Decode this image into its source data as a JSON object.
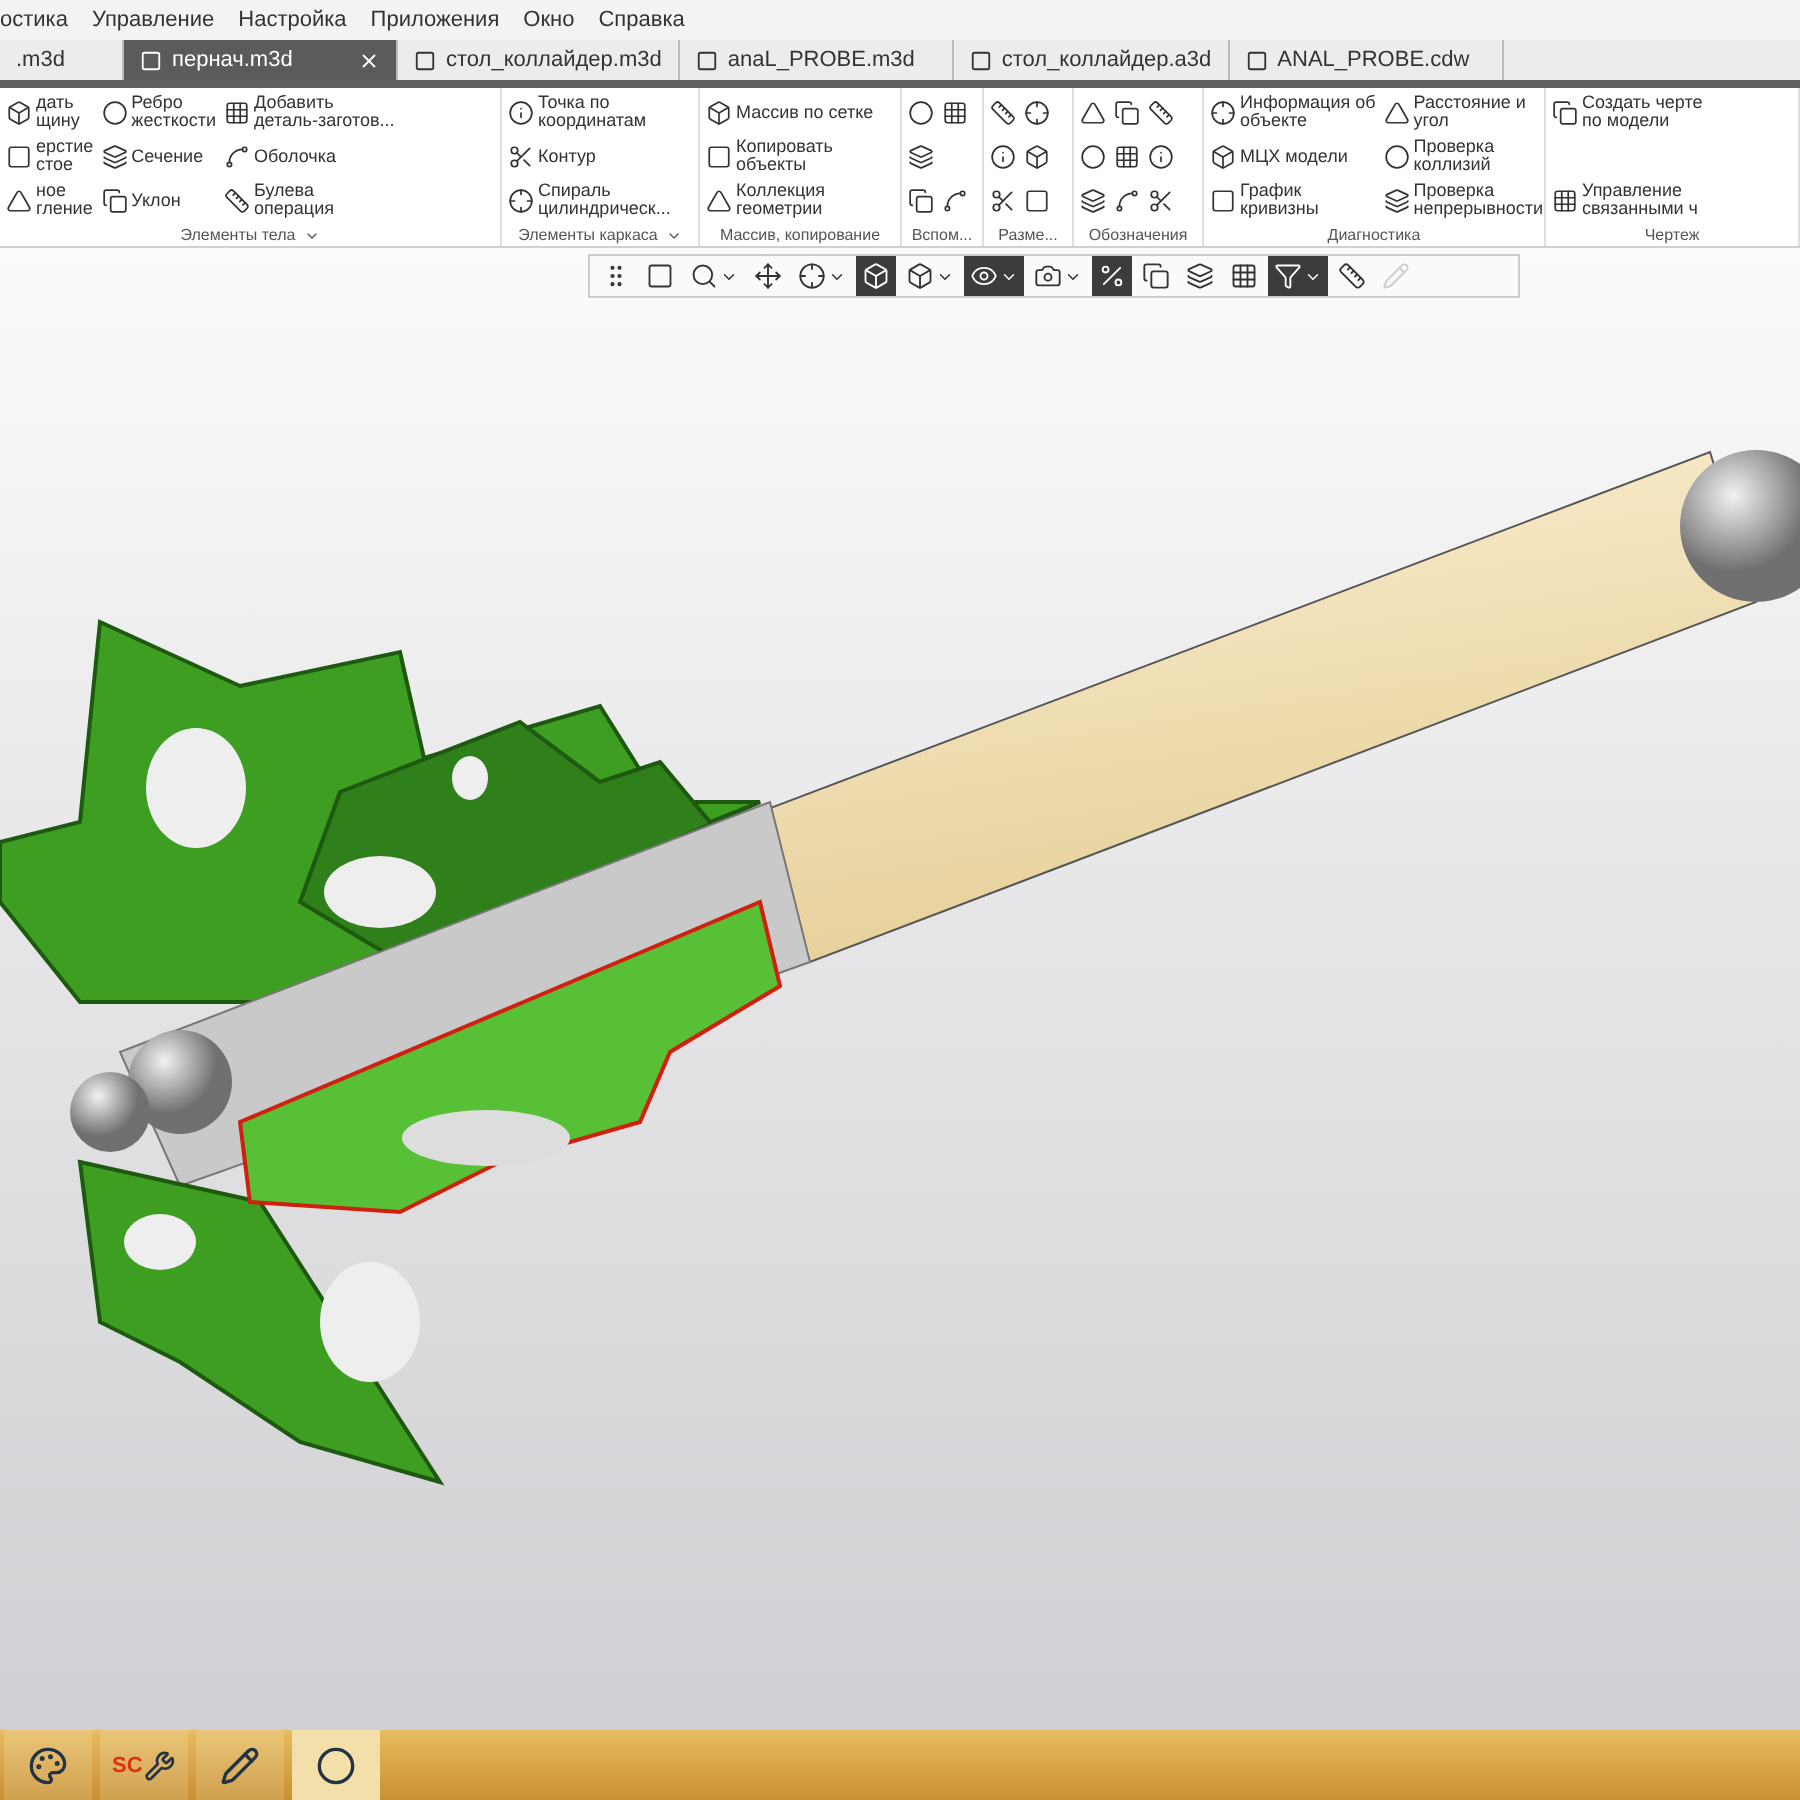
{
  "menu": [
    "остика",
    "Управление",
    "Настройка",
    "Приложения",
    "Окно",
    "Справка"
  ],
  "tabs": [
    {
      "label": ".m3d",
      "selected": false,
      "closable": false
    },
    {
      "label": "пернач.m3d",
      "selected": true,
      "closable": true
    },
    {
      "label": "стол_коллайдер.m3d",
      "selected": false,
      "closable": false
    },
    {
      "label": "anaL_PROBE.m3d",
      "selected": false,
      "closable": false
    },
    {
      "label": "стол_коллайдер.a3d",
      "selected": false,
      "closable": false
    },
    {
      "label": "ANAL_PROBE.cdw",
      "selected": false,
      "closable": false
    }
  ],
  "ribbon": {
    "groups": [
      {
        "label": "Элементы тела",
        "menu": true,
        "columns": [
          [
            {
              "kind": "large",
              "label": "дать\nщину"
            },
            {
              "kind": "large",
              "label": "ерстие\nстое"
            },
            {
              "kind": "large",
              "label": "ное\nгление"
            }
          ],
          [
            {
              "kind": "large",
              "label": "Ребро\nжесткости"
            },
            {
              "kind": "large",
              "label": "Сечение"
            },
            {
              "kind": "large",
              "label": "Уклон"
            }
          ],
          [
            {
              "kind": "large",
              "label": "Добавить\nдеталь-заготов..."
            },
            {
              "kind": "large",
              "label": "Оболочка"
            },
            {
              "kind": "large",
              "label": "Булева\nоперация"
            }
          ]
        ]
      },
      {
        "label": "Элементы каркаса",
        "menu": true,
        "columns": [
          [
            {
              "kind": "large",
              "label": "Точка по\nкоординатам"
            },
            {
              "kind": "large",
              "label": "Контур"
            },
            {
              "kind": "large",
              "label": "Спираль\nцилиндрическ..."
            }
          ]
        ]
      },
      {
        "label": "Массив, копирование",
        "menu": false,
        "columns": [
          [
            {
              "kind": "large",
              "label": "Массив по сетке"
            },
            {
              "kind": "large",
              "label": "Копировать\nобъекты"
            },
            {
              "kind": "large",
              "label": "Коллекция\nгеометрии"
            }
          ]
        ]
      },
      {
        "label": "Вспом...",
        "menu": false,
        "columns": [
          [
            {
              "kind": "icon"
            },
            {
              "kind": "icon"
            },
            {
              "kind": "icon"
            }
          ],
          [
            {
              "kind": "icon"
            },
            {
              "kind": "icon"
            }
          ]
        ]
      },
      {
        "label": "Разме...",
        "menu": false,
        "columns": [
          [
            {
              "kind": "icon"
            },
            {
              "kind": "icon"
            },
            {
              "kind": "icon"
            }
          ],
          [
            {
              "kind": "icon"
            },
            {
              "kind": "icon"
            },
            {
              "kind": "icon"
            }
          ]
        ]
      },
      {
        "label": "Обозначения",
        "menu": false,
        "columns": [
          [
            {
              "kind": "icon"
            },
            {
              "kind": "icon"
            },
            {
              "kind": "icon"
            }
          ],
          [
            {
              "kind": "icon"
            },
            {
              "kind": "icon"
            },
            {
              "kind": "icon"
            }
          ],
          [
            {
              "kind": "icon"
            },
            {
              "kind": "icon"
            },
            {
              "kind": "icon"
            }
          ]
        ]
      },
      {
        "label": "Диагностика",
        "menu": false,
        "columns": [
          [
            {
              "kind": "large",
              "label": "Информация об\nобъекте"
            },
            {
              "kind": "large",
              "label": "МЦХ модели"
            },
            {
              "kind": "large",
              "label": "График\nкривизны"
            }
          ],
          [
            {
              "kind": "large",
              "label": "Расстояние и\nугол"
            },
            {
              "kind": "large",
              "label": "Проверка\nколлизий"
            },
            {
              "kind": "large",
              "label": "Проверка\nнепрерывности"
            }
          ]
        ]
      },
      {
        "label": "Чертеж",
        "menu": false,
        "columns": [
          [
            {
              "kind": "large",
              "label": "Создать черте\nпо модели"
            },
            {
              "kind": "large",
              "label": "Управление\nсвязанными ч"
            }
          ]
        ]
      }
    ]
  },
  "toolbar": [
    {
      "selected": false,
      "dropdown": false
    },
    {
      "selected": false,
      "dropdown": false
    },
    {
      "selected": false,
      "dropdown": true
    },
    {
      "selected": false,
      "dropdown": false
    },
    {
      "selected": false,
      "dropdown": true
    },
    {
      "selected": true,
      "dropdown": false
    },
    {
      "selected": false,
      "dropdown": true
    },
    {
      "selected": true,
      "dropdown": true
    },
    {
      "selected": false,
      "dropdown": true
    },
    {
      "selected": true,
      "dropdown": false
    },
    {
      "selected": false,
      "dropdown": false
    },
    {
      "selected": false,
      "dropdown": false
    },
    {
      "selected": false,
      "dropdown": false
    },
    {
      "selected": true,
      "dropdown": true
    },
    {
      "selected": false,
      "dropdown": false
    },
    {
      "selected": false,
      "dropdown": false,
      "disabled": true
    }
  ],
  "taskbar": [
    {
      "selected": false
    },
    {
      "selected": false,
      "badge": "SC"
    },
    {
      "selected": false
    },
    {
      "selected": true
    }
  ]
}
